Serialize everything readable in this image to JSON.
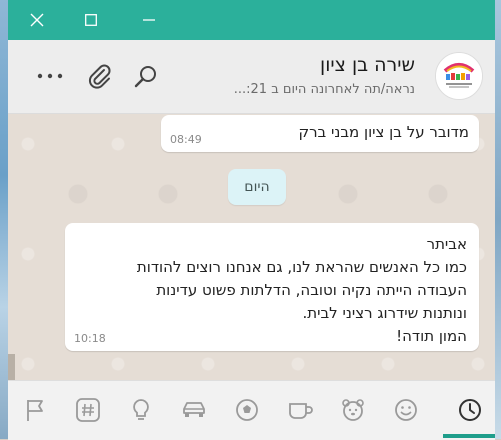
{
  "window": {
    "accent": "#2bb09b",
    "title_controls": [
      "close-icon",
      "maximize-icon",
      "minimize-icon"
    ]
  },
  "header": {
    "contact_name": "שירה בן ציון",
    "status": "נראה/תה לאחרונה היום ב 21:...",
    "icons": [
      "more-icon",
      "paperclip-icon",
      "search-icon"
    ]
  },
  "messages": [
    {
      "text": "מדובר על בן ציון מבני ברק",
      "time": "08:49"
    },
    {
      "lines": [
        "אביתר",
        "כמו כל האנשים שהראת לנו, גם אנחנו רוצים להודות",
        "העבודה הייתה נקיה וטובה, הדלתות פשוט עדינות",
        "ונותנות שידרוג רציני לבית.",
        "המון תודה!"
      ],
      "time": "10:18"
    }
  ],
  "date_separator": "היום",
  "emoji_tabs": [
    "flag-icon",
    "hashtag-icon",
    "lightbulb-icon",
    "car-icon",
    "ball-icon",
    "cup-icon",
    "animal-icon",
    "smiley-icon",
    "clock-icon"
  ],
  "active_tab": "clock-icon"
}
